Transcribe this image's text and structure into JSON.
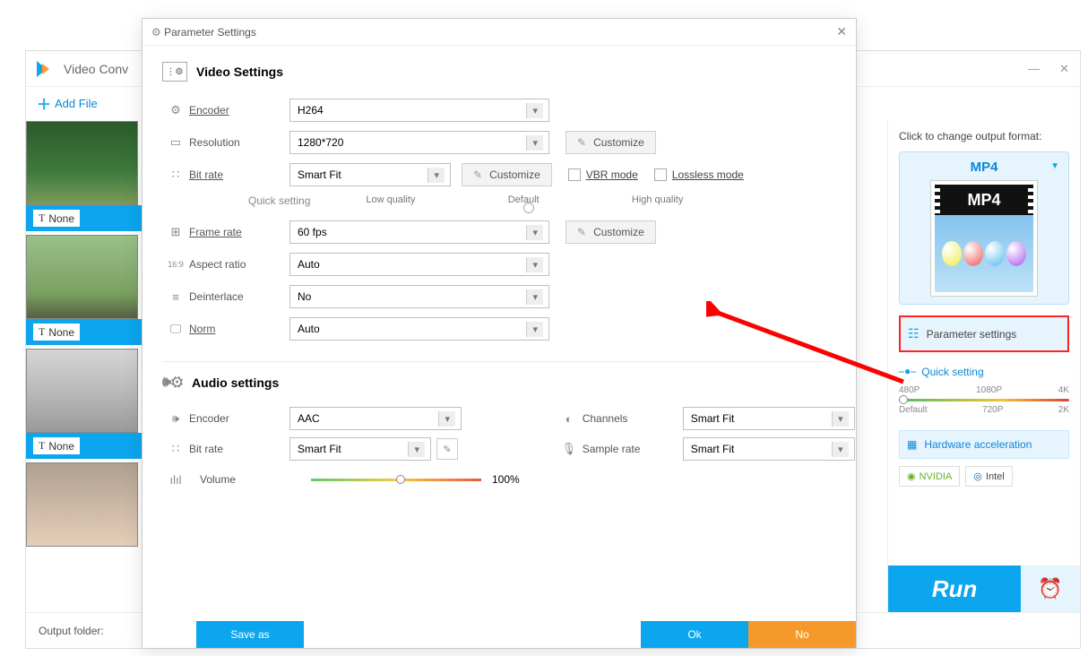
{
  "app": {
    "title": "Video Conv",
    "add_file": "Add File"
  },
  "video_list": {
    "items": [
      {
        "caption": "None"
      },
      {
        "caption": "None"
      },
      {
        "caption": "None"
      }
    ]
  },
  "output_bar": {
    "label": "Output folder:"
  },
  "right": {
    "hint": "Click to change output format:",
    "format": "MP4",
    "param_btn": "Parameter settings",
    "quick_setting": "Quick setting",
    "ticks_top": [
      "480P",
      "1080P",
      "4K"
    ],
    "ticks_bot": [
      "Default",
      "720P",
      "2K"
    ],
    "hw": "Hardware acceleration",
    "nvidia": "NVIDIA",
    "intel": "Intel",
    "run": "Run"
  },
  "dialog": {
    "title": "Parameter Settings",
    "video_hdr": "Video Settings",
    "audio_hdr": "Audio settings",
    "video": {
      "encoder_label": "Encoder",
      "encoder": "H264",
      "resolution_label": "Resolution",
      "resolution": "1280*720",
      "res_customize": "Customize",
      "bitrate_label": "Bit rate",
      "bitrate": "Smart Fit",
      "br_customize": "Customize",
      "vbr_label": "VBR mode",
      "lossless_label": "Lossless mode",
      "quick_setting_label": "Quick setting",
      "q_low": "Low quality",
      "q_def": "Default",
      "q_high": "High quality",
      "framerate_label": "Frame rate",
      "framerate": "60 fps",
      "fr_customize": "Customize",
      "aspect_label": "Aspect ratio",
      "aspect": "Auto",
      "deint_label": "Deinterlace",
      "deint": "No",
      "norm_label": "Norm",
      "norm": "Auto"
    },
    "audio": {
      "encoder_label": "Encoder",
      "encoder": "AAC",
      "bitrate_label": "Bit rate",
      "bitrate": "Smart Fit",
      "volume_label": "Volume",
      "volume_pct": "100%",
      "channels_label": "Channels",
      "channels": "Smart Fit",
      "sample_label": "Sample rate",
      "sample": "Smart Fit"
    },
    "buttons": {
      "saveas": "Save as",
      "ok": "Ok",
      "no": "No"
    }
  }
}
